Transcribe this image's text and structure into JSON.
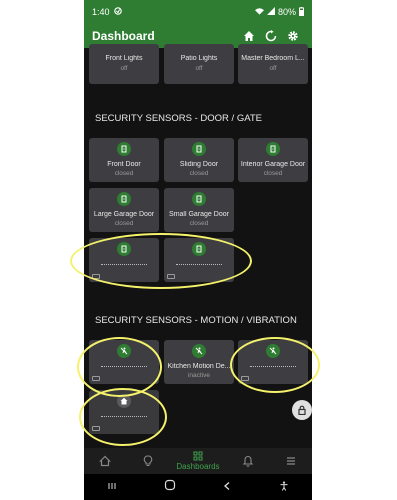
{
  "status_bar": {
    "time": "1:40",
    "battery": "80%"
  },
  "app_bar": {
    "title": "Dashboard"
  },
  "top_tiles": [
    {
      "label": "Front Lights",
      "state": "off"
    },
    {
      "label": "Patio Lights",
      "state": "off"
    },
    {
      "label": "Master Bedroom L...",
      "state": "off"
    }
  ],
  "sections": {
    "door_gate": "SECURITY SENSORS - DOOR / GATE",
    "motion_vibration": "SECURITY SENSORS - MOTION / VIBRATION"
  },
  "door_tiles": [
    {
      "label": "Front Door",
      "state": "closed"
    },
    {
      "label": "Sliding Door",
      "state": "closed"
    },
    {
      "label": "Interior Garage Door",
      "state": "closed"
    },
    {
      "label": "Large Garage Door",
      "state": "closed"
    },
    {
      "label": "Small Garage Door",
      "state": "closed"
    }
  ],
  "motion_tiles": [
    {
      "label": "Kitchen Motion De...",
      "state": "inactive"
    }
  ],
  "nav": {
    "active_label": "Dashboards"
  },
  "colors": {
    "accent": "#2e7d32",
    "highlight": "#f4f16b",
    "tile": "#3e3e42",
    "background": "#121212"
  }
}
